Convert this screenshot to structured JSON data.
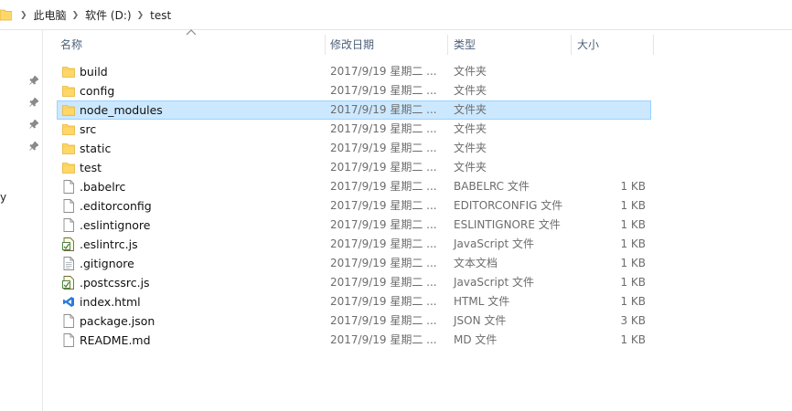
{
  "breadcrumb": {
    "items": [
      "此电脑",
      "软件 (D:)",
      "test"
    ]
  },
  "nav": {
    "truncated_label": "y"
  },
  "columns": {
    "name": "名称",
    "date": "修改日期",
    "type": "类型",
    "size": "大小"
  },
  "files": [
    {
      "name": "build",
      "date": "2017/9/19 星期二 ...",
      "type": "文件夹",
      "size": "",
      "icon": "folder-icon"
    },
    {
      "name": "config",
      "date": "2017/9/19 星期二 ...",
      "type": "文件夹",
      "size": "",
      "icon": "folder-icon"
    },
    {
      "name": "node_modules",
      "date": "2017/9/19 星期二 ...",
      "type": "文件夹",
      "size": "",
      "icon": "folder-icon",
      "selected": true
    },
    {
      "name": "src",
      "date": "2017/9/19 星期二 ...",
      "type": "文件夹",
      "size": "",
      "icon": "folder-icon"
    },
    {
      "name": "static",
      "date": "2017/9/19 星期二 ...",
      "type": "文件夹",
      "size": "",
      "icon": "folder-icon"
    },
    {
      "name": "test",
      "date": "2017/9/19 星期二 ...",
      "type": "文件夹",
      "size": "",
      "icon": "folder-icon"
    },
    {
      "name": ".babelrc",
      "date": "2017/9/19 星期二 ...",
      "type": "BABELRC 文件",
      "size": "1 KB",
      "icon": "file-icon"
    },
    {
      "name": ".editorconfig",
      "date": "2017/9/19 星期二 ...",
      "type": "EDITORCONFIG 文件",
      "size": "1 KB",
      "icon": "file-icon"
    },
    {
      "name": ".eslintignore",
      "date": "2017/9/19 星期二 ...",
      "type": "ESLINTIGNORE 文件",
      "size": "1 KB",
      "icon": "file-icon"
    },
    {
      "name": ".eslintrc.js",
      "date": "2017/9/19 星期二 ...",
      "type": "JavaScript 文件",
      "size": "1 KB",
      "icon": "script-file-icon"
    },
    {
      "name": ".gitignore",
      "date": "2017/9/19 星期二 ...",
      "type": "文本文档",
      "size": "1 KB",
      "icon": "text-file-icon"
    },
    {
      "name": ".postcssrc.js",
      "date": "2017/9/19 星期二 ...",
      "type": "JavaScript 文件",
      "size": "1 KB",
      "icon": "script-file-icon"
    },
    {
      "name": "index.html",
      "date": "2017/9/19 星期二 ...",
      "type": "HTML 文件",
      "size": "1 KB",
      "icon": "vscode-file-icon"
    },
    {
      "name": "package.json",
      "date": "2017/9/19 星期二 ...",
      "type": "JSON 文件",
      "size": "3 KB",
      "icon": "file-icon"
    },
    {
      "name": "README.md",
      "date": "2017/9/19 星期二 ...",
      "type": "MD 文件",
      "size": "1 KB",
      "icon": "file-icon"
    }
  ],
  "colors": {
    "selection_fill": "#cce8ff",
    "selection_border": "#99d1ff",
    "folder": "#ffd766",
    "header_text": "#4c607a"
  }
}
